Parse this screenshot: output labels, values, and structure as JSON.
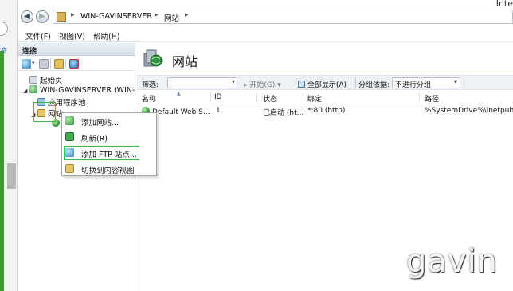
{
  "window": {
    "title_fragment": "Inte"
  },
  "address": {
    "host": "WIN-GAVINSERVER",
    "node": "网站"
  },
  "menu": {
    "file": "文件(F)",
    "view": "视图(V)",
    "help": "帮助(H)"
  },
  "connections": {
    "title": "连接",
    "tree": {
      "start_page": "起始页",
      "server": "WIN-GAVINSERVER (WIN-",
      "app_pools": "应用程序池",
      "sites": "网站"
    }
  },
  "main": {
    "title": "网站",
    "filter": {
      "label": "筛选:",
      "start": "开始(G)",
      "show_all": "全部显示(A)",
      "group_label": "分组依据:",
      "group_value": "不进行分组"
    },
    "columns": [
      "名称",
      "ID",
      "状态",
      "绑定",
      "路径"
    ],
    "rows": [
      {
        "name": "Default Web S...",
        "id": "1",
        "status": "已启动 (ht...",
        "binding": "*:80 (http)",
        "path": "%SystemDrive%\\inetpub\\"
      }
    ]
  },
  "context_menu": {
    "items": [
      "添加网站...",
      "刷新(R)",
      "添加 FTP 站点...",
      "切换到内容视图"
    ],
    "highlighted": "添加 FTP 站点..."
  },
  "watermark": "gavin",
  "colors": {
    "highlight_green": "#3db84a",
    "globe_green": "#2b8a3a"
  }
}
